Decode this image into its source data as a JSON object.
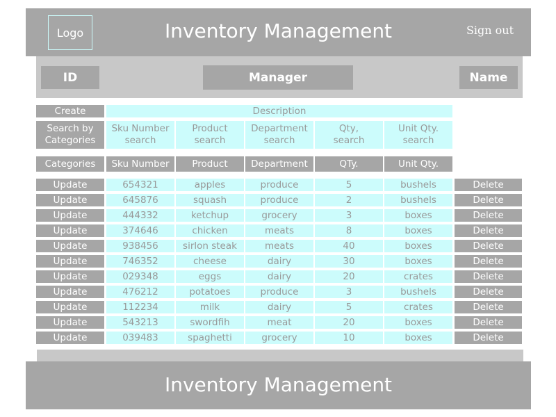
{
  "header": {
    "logo_label": "Logo",
    "title": "Inventory Management",
    "signout_label": "Sign out"
  },
  "subheader": {
    "id_label": "ID",
    "manager_label": "Manager",
    "name_label": "Name"
  },
  "toolbar": {
    "create_label": "Create",
    "description_label": "Description"
  },
  "search": {
    "label": "Search by\nCategories",
    "fields": [
      "Sku Number\nsearch",
      "Product\nsearch",
      "Department\nsearch",
      "Qty,\nsearch",
      "Unit Qty.\nsearch"
    ]
  },
  "table": {
    "categories_label": "Categories",
    "columns": [
      "Sku Number",
      "Product",
      "Department",
      "QTy.",
      "Unit Qty."
    ],
    "update_label": "Update",
    "delete_label": "Delete",
    "rows": [
      [
        "654321",
        "apples",
        "produce",
        "5",
        "bushels"
      ],
      [
        "645876",
        "squash",
        "produce",
        "2",
        "bushels"
      ],
      [
        "444332",
        "ketchup",
        "grocery",
        "3",
        "boxes"
      ],
      [
        "374646",
        "chicken",
        "meats",
        "8",
        "boxes"
      ],
      [
        "938456",
        "sirlon steak",
        "meats",
        "40",
        "boxes"
      ],
      [
        "746352",
        "cheese",
        "dairy",
        "30",
        "boxes"
      ],
      [
        "029348",
        "eggs",
        "dairy",
        "20",
        "crates"
      ],
      [
        "476212",
        "potatoes",
        "produce",
        "3",
        "bushels"
      ],
      [
        "112234",
        "milk",
        "dairy",
        "5",
        "crates"
      ],
      [
        "543213",
        "swordfih",
        "meat",
        "20",
        "boxes"
      ],
      [
        "039483",
        "spaghetti",
        "grocery",
        "10",
        "boxes"
      ]
    ]
  },
  "footer": {
    "title": "Inventory Management"
  },
  "colors": {
    "gray": "#a6a6a6",
    "light_gray": "#c8c8c8",
    "cyan": "#ccfcfc",
    "text_gray": "#999999"
  }
}
